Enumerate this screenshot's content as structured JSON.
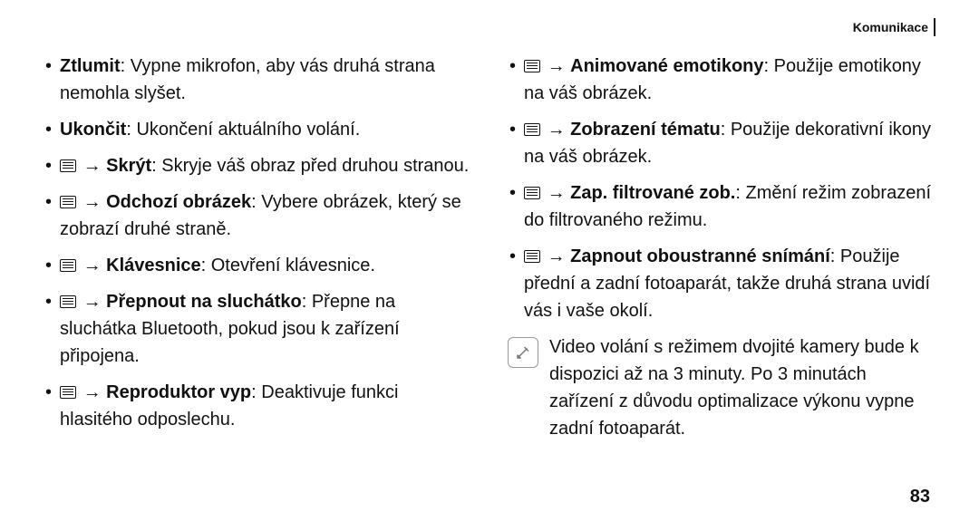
{
  "header": {
    "section": "Komunikace"
  },
  "arrow": "→",
  "left": {
    "items": [
      {
        "bold": "Ztlumit",
        "rest": ": Vypne mikrofon, aby vás druhá strana nemohla slyšet.",
        "menu": false
      },
      {
        "bold": "Ukončit",
        "rest": ": Ukončení aktuálního volání.",
        "menu": false
      },
      {
        "bold": "Skrýt",
        "rest": ": Skryje váš obraz před druhou stranou.",
        "menu": true
      },
      {
        "bold": "Odchozí obrázek",
        "rest": ": Vybere obrázek, který se zobrazí druhé straně.",
        "menu": true
      },
      {
        "bold": "Klávesnice",
        "rest": ": Otevření klávesnice.",
        "menu": true
      },
      {
        "bold": "Přepnout na sluchátko",
        "rest": ": Přepne na sluchátka Bluetooth, pokud jsou k zařízení připojena.",
        "menu": true
      },
      {
        "bold": "Reproduktor vyp",
        "rest": ": Deaktivuje funkci hlasitého odposlechu.",
        "menu": true
      }
    ]
  },
  "right": {
    "items": [
      {
        "bold": "Animované emotikony",
        "rest": ": Použije emotikony na váš obrázek.",
        "menu": true
      },
      {
        "bold": "Zobrazení tématu",
        "rest": ": Použije dekorativní ikony na váš obrázek.",
        "menu": true
      },
      {
        "bold": "Zap. filtrované zob.",
        "rest": ": Změní režim zobrazení do filtrovaného režimu.",
        "menu": true
      },
      {
        "bold": "Zapnout oboustranné snímání",
        "rest": ": Použije přední a zadní fotoaparát, takže druhá strana uvidí vás i vaše okolí.",
        "menu": true
      }
    ],
    "note": "Video volání s režimem dvojité kamery bude k dispozici až na 3 minuty. Po 3 minutách zařízení z důvodu optimalizace výkonu vypne zadní fotoaparát."
  },
  "page_number": "83"
}
